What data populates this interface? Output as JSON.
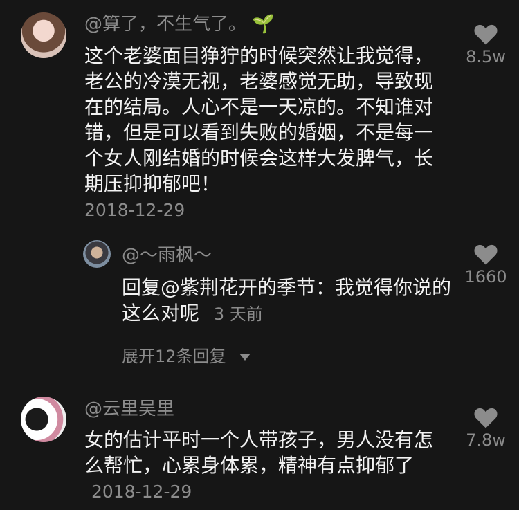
{
  "comments": [
    {
      "username": "@算了，不生气了。",
      "username_emoji": "🌱",
      "text": "这个老婆面目狰狞的时候突然让我觉得，老公的冷漠无视，老婆感觉无助，导致现在的结局。人心不是一天凉的。不知谁对错，但是可以看到失败的婚姻，不是每一个女人刚结婚的时候会这样大发脾气，长期压抑抑郁吧！",
      "date": "2018-12-29",
      "likes": "8.5w",
      "reply": {
        "username": "@～雨枫～",
        "text": "回复@紫荆花开的季节：我觉得你说的这么对呢",
        "time": "3 天前",
        "likes": "1660"
      },
      "expand_label": "展开12条回复"
    },
    {
      "username": "@云里吴里",
      "text": "女的估计平时一个人带孩子，男人没有怎么帮忙，心累身体累，精神有点抑郁了",
      "date": "2018-12-29",
      "likes": "7.8w"
    }
  ],
  "icons": {
    "like": "heart-icon",
    "expand": "caret-down-icon"
  },
  "colors": {
    "background": "#161616",
    "muted": "#8c8c8c",
    "text": "#f2f2f2"
  }
}
